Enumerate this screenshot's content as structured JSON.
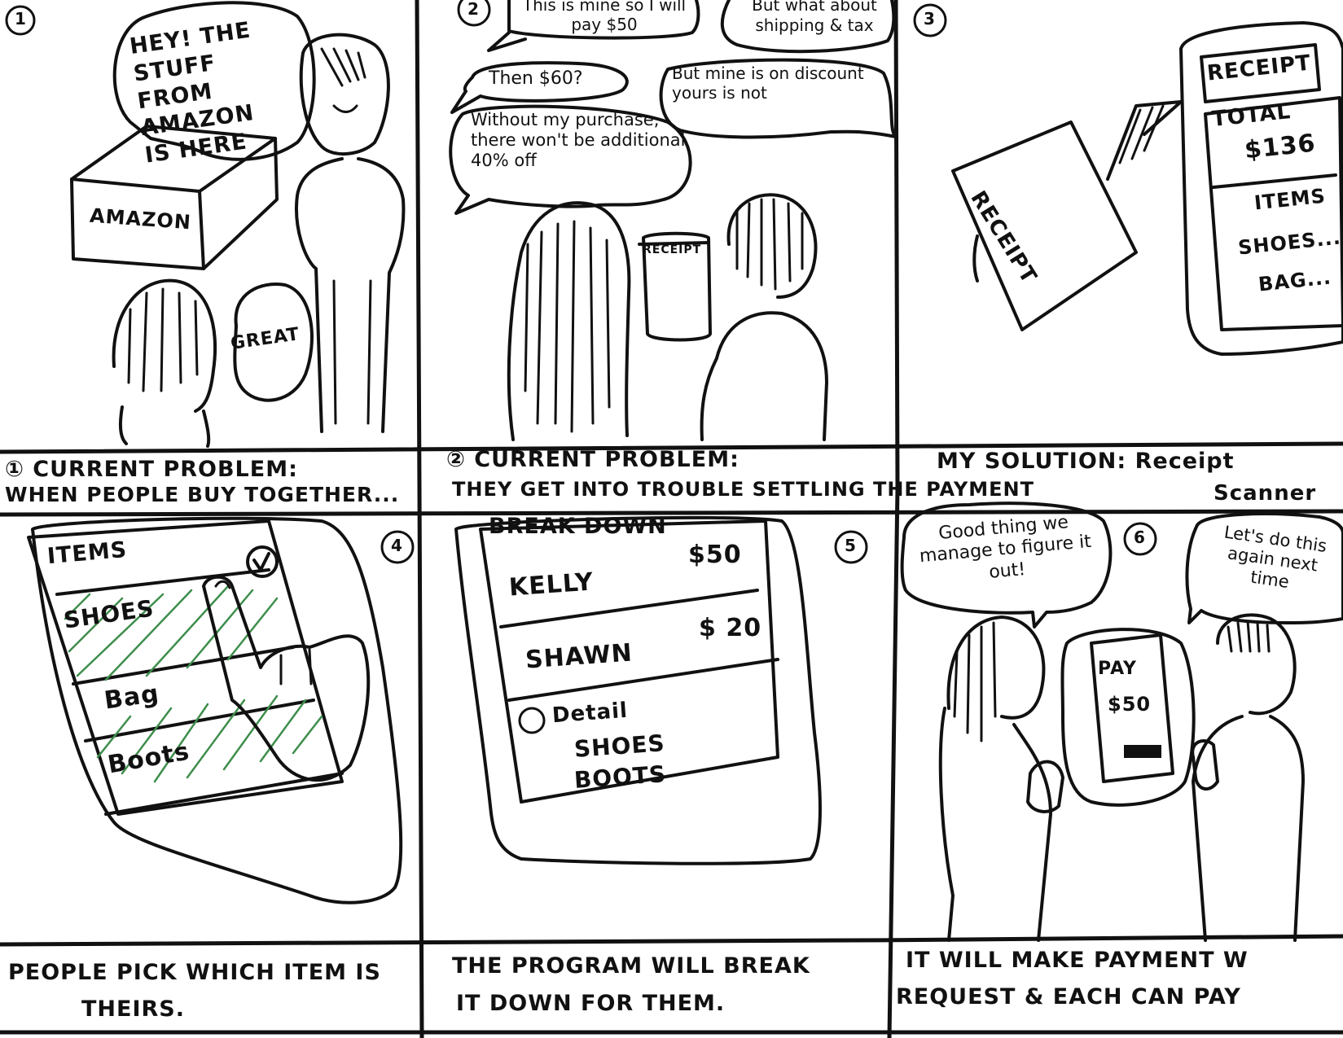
{
  "panel_numbers": [
    "1",
    "2",
    "3",
    "4",
    "5",
    "6"
  ],
  "panel1": {
    "bubble_hey": "HEY! THE STUFF FROM AMAZON IS HERE",
    "box_label": "AMAZON",
    "bubble_great": "GREAT",
    "caption_line1": "① CURRENT PROBLEM:",
    "caption_line2": "WHEN PEOPLE BUY TOGETHER..."
  },
  "panel2": {
    "bubble_mine": "This is mine so I will pay $50",
    "bubble_shipping": "But what about shipping & tax",
    "bubble_then": "Then $60?",
    "bubble_discount": "But mine is on discount yours is not",
    "bubble_without": "Without my purchase, there won't be additional 40% off",
    "receipt_label": "RECEIPT",
    "caption_line1": "② CURRENT PROBLEM:",
    "caption_line2": "THEY GET INTO TROUBLE SETTLING THE PAYMENT"
  },
  "panel3": {
    "paper_label": "RECEIPT",
    "phone_title": "RECEIPT",
    "phone_total_label": "TOTAL",
    "phone_total_value": "$136",
    "phone_items_label": "ITEMS",
    "phone_item1": "SHOES...",
    "phone_item2": "BAG...",
    "caption_line1": "MY SOLUTION: Receipt",
    "caption_line2": "Scanner"
  },
  "panel4": {
    "list_header": "ITEMS",
    "items": [
      "SHOES",
      "Bag",
      "Boots"
    ],
    "caption_line1": "PEOPLE PICK WHICH ITEM IS",
    "caption_line2": "THEIRS."
  },
  "panel5": {
    "screen_title": "BREAK DOWN",
    "people": [
      {
        "name": "KELLY",
        "amount": "$50"
      },
      {
        "name": "SHAWN",
        "amount": "$ 20"
      }
    ],
    "detail_label": "Detail",
    "detail_items": [
      "SHOES",
      "BOOTS"
    ],
    "caption_line1": "THE PROGRAM WILL BREAK",
    "caption_line2": "IT DOWN FOR THEM."
  },
  "panel6": {
    "bubble_good": "Good thing we manage to figure it out!",
    "bubble_again": "Let's do this again next time",
    "phone_pay_label": "PAY",
    "phone_pay_amount": "$50",
    "caption_line1": "IT WILL MAKE PAYMENT W",
    "caption_line2": "REQUEST & EACH CAN PAY"
  }
}
